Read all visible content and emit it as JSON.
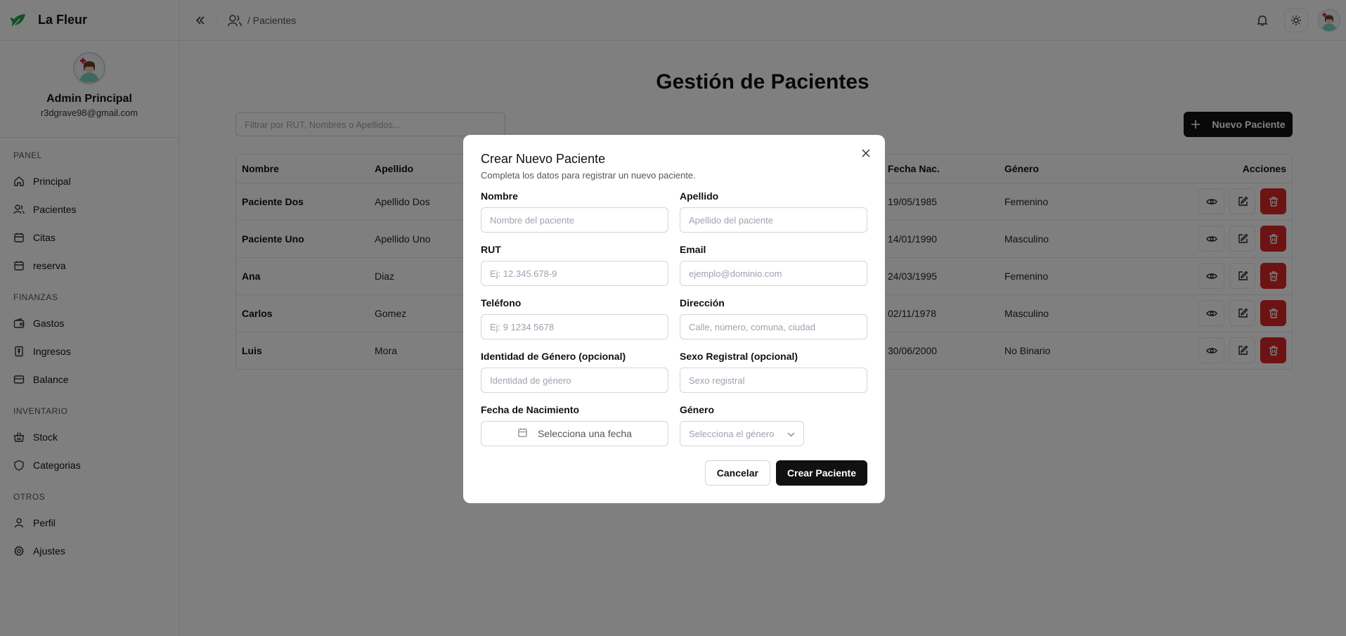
{
  "brand": {
    "name": "La Fleur"
  },
  "profile": {
    "name": "Admin Principal",
    "email": "r3dgrave98@gmail.com"
  },
  "sidebar": {
    "sections": [
      {
        "title": "PANEL",
        "items": [
          {
            "label": "Principal",
            "icon": "home-icon"
          },
          {
            "label": "Pacientes",
            "icon": "users-icon"
          },
          {
            "label": "Citas",
            "icon": "calendar-icon"
          },
          {
            "label": "reserva",
            "icon": "calendar-icon"
          }
        ]
      },
      {
        "title": "FINANZAS",
        "items": [
          {
            "label": "Gastos",
            "icon": "wallet-icon"
          },
          {
            "label": "Ingresos",
            "icon": "receipt-icon"
          },
          {
            "label": "Balance",
            "icon": "card-icon"
          }
        ]
      },
      {
        "title": "INVENTARIO",
        "items": [
          {
            "label": "Stock",
            "icon": "basket-icon"
          },
          {
            "label": "Categorias",
            "icon": "shield-icon"
          }
        ]
      },
      {
        "title": "OTROS",
        "items": [
          {
            "label": "Perfil",
            "icon": "user-icon"
          },
          {
            "label": "Ajustes",
            "icon": "gear-icon"
          }
        ]
      }
    ]
  },
  "topbar": {
    "breadcrumb": "/ Pacientes"
  },
  "main": {
    "title": "Gestión de Pacientes",
    "filter_placeholder": "Filtrar por RUT, Nombres o Apellidos...",
    "new_button": "Nuevo Paciente",
    "table": {
      "headers": [
        "Nombre",
        "Apellido",
        "Fecha Nac.",
        "Género",
        "Acciones"
      ],
      "rows": [
        {
          "nombre": "Paciente Dos",
          "apellido": "Apellido Dos",
          "fecha": "19/05/1985",
          "genero": "Femenino"
        },
        {
          "nombre": "Paciente Uno",
          "apellido": "Apellido Uno",
          "fecha": "14/01/1990",
          "genero": "Masculino"
        },
        {
          "nombre": "Ana",
          "apellido": "Diaz",
          "fecha": "24/03/1995",
          "genero": "Femenino"
        },
        {
          "nombre": "Carlos",
          "apellido": "Gomez",
          "fecha": "02/11/1978",
          "genero": "Masculino"
        },
        {
          "nombre": "Luis",
          "apellido": "Mora",
          "fecha": "30/06/2000",
          "genero": "No Binario"
        }
      ]
    }
  },
  "modal": {
    "title": "Crear Nuevo Paciente",
    "description": "Completa los datos para registrar un nuevo paciente.",
    "fields": {
      "nombre": {
        "label": "Nombre",
        "placeholder": "Nombre del paciente"
      },
      "apellido": {
        "label": "Apellido",
        "placeholder": "Apellido del paciente"
      },
      "rut": {
        "label": "RUT",
        "placeholder": "Ej: 12.345.678-9"
      },
      "email": {
        "label": "Email",
        "placeholder": "ejemplo@dominio.com"
      },
      "telefono": {
        "label": "Teléfono",
        "placeholder": "Ej: 9 1234 5678"
      },
      "direccion": {
        "label": "Dirección",
        "placeholder": "Calle, número, comuna, ciudad"
      },
      "identidad": {
        "label": "Identidad de Género (opcional)",
        "placeholder": "Identidad de género"
      },
      "sexo": {
        "label": "Sexo Registral (opcional)",
        "placeholder": "Sexo registral"
      },
      "fecha": {
        "label": "Fecha de Nacimiento",
        "placeholder": "Selecciona una fecha"
      },
      "genero": {
        "label": "Género",
        "placeholder": "Selecciona el género"
      }
    },
    "cancel_label": "Cancelar",
    "submit_label": "Crear Paciente"
  },
  "colors": {
    "accent": "#111111",
    "danger": "#dc2626",
    "overlay": "rgba(0,0,0,0.5)"
  }
}
